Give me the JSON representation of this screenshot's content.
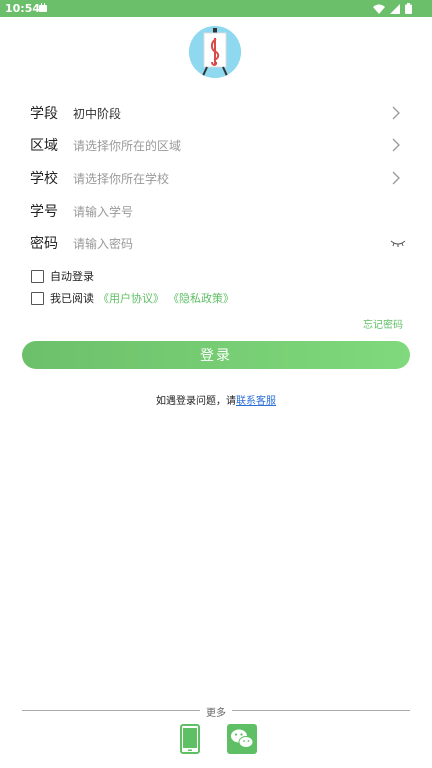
{
  "status_bar": {
    "time": "10:54"
  },
  "form": {
    "fields": [
      {
        "label": "学段",
        "value": "初中阶段",
        "placeholder": ""
      },
      {
        "label": "区域",
        "value": "",
        "placeholder": "请选择你所在的区域"
      },
      {
        "label": "学校",
        "value": "",
        "placeholder": "请选择你所在学校"
      },
      {
        "label": "学号",
        "value": "",
        "placeholder": "请输入学号"
      },
      {
        "label": "密码",
        "value": "",
        "placeholder": "请输入密码"
      }
    ],
    "auto_login_label": "自动登录",
    "agree_prefix": "我已阅读",
    "user_agreement_link": "《用户协议》",
    "privacy_link": "《隐私政策》",
    "forgot_password": "忘记密码",
    "login_button": "登录"
  },
  "help": {
    "prefix": "如遇登录问题，请",
    "contact_link": "联系客服"
  },
  "footer": {
    "more_label": "更多"
  },
  "colors": {
    "accent": "#6cbf6a",
    "link": "#2a6fd6"
  },
  "icons": {
    "logo": "music-easel-logo",
    "phone": "phone-login-icon",
    "wechat": "wechat-login-icon"
  }
}
